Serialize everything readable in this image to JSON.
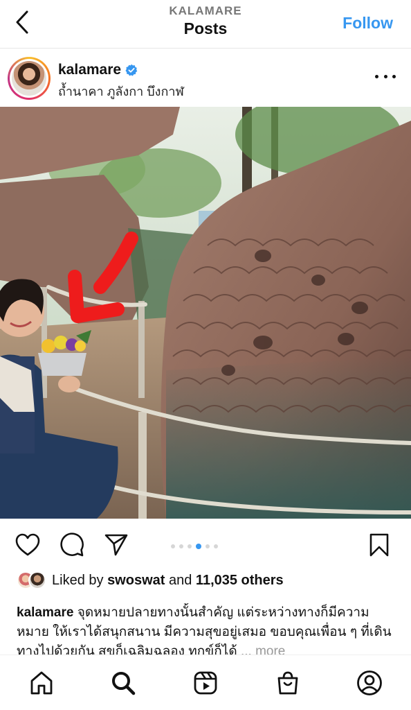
{
  "header": {
    "username": "KALAMARE",
    "title": "Posts",
    "follow_label": "Follow"
  },
  "post": {
    "username": "kalamare",
    "verified": true,
    "location": "ถ้ำนาคา ภูลังกา บึงกาฬ",
    "carousel": {
      "count": 6,
      "active_index": 3
    },
    "likes": {
      "prefix": "Liked by",
      "user": "swoswat",
      "middle": "and",
      "others": "11,035 others"
    },
    "caption": {
      "username": "kalamare",
      "text": "จุดหมายปลายทางนั้นสำคัญ แต่ระหว่างทางก็มีความหมาย ให้เราได้สนุกสนาน มีความสุขอยู่เสมอ ขอบคุณเพื่อน ๆ ที่เดินทางไปด้วยกัน สุขก็เฉลิมฉลอง ทุกข์ก็ได้",
      "more_label": "... more"
    }
  },
  "icons": {
    "back": "chevron-left-icon",
    "more": "more-horizontal-icon",
    "like": "heart-icon",
    "comment": "comment-icon",
    "share": "send-icon",
    "save": "bookmark-icon",
    "nav": [
      "home-icon",
      "search-icon",
      "reels-icon",
      "shop-icon",
      "profile-icon"
    ]
  },
  "colors": {
    "accent": "#3797f0",
    "annotation_arrow": "#ee1c1c"
  }
}
